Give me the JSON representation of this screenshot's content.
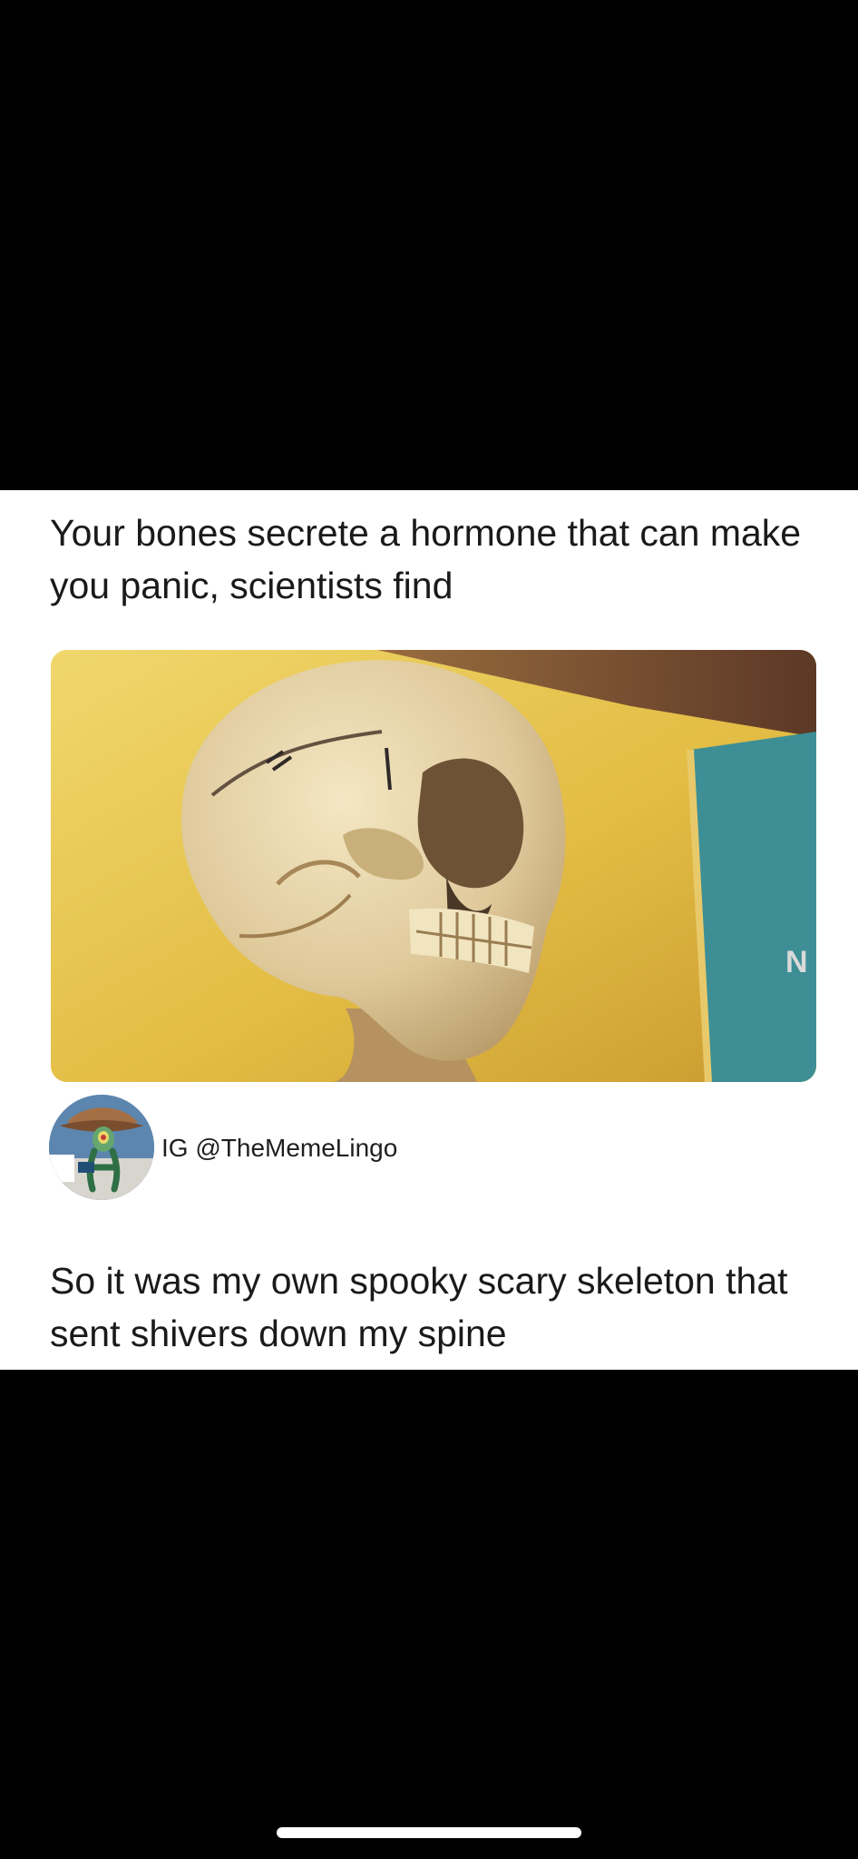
{
  "post": {
    "headline": "Your bones secrete a hormone that can make you panic, scientists find",
    "handle": "IG @TheMemeLingo",
    "caption": "So it was my own spooky scary skeleton that sent shivers down my spine",
    "image_icon": "skull-photo",
    "avatar_icon": "cartoon-avatar"
  },
  "colors": {
    "background": "#000000",
    "card": "#ffffff",
    "text": "#1a1a1a",
    "photo_wall": "#e4c24a",
    "photo_panel": "#3d8f95",
    "home_indicator": "#ffffff"
  }
}
